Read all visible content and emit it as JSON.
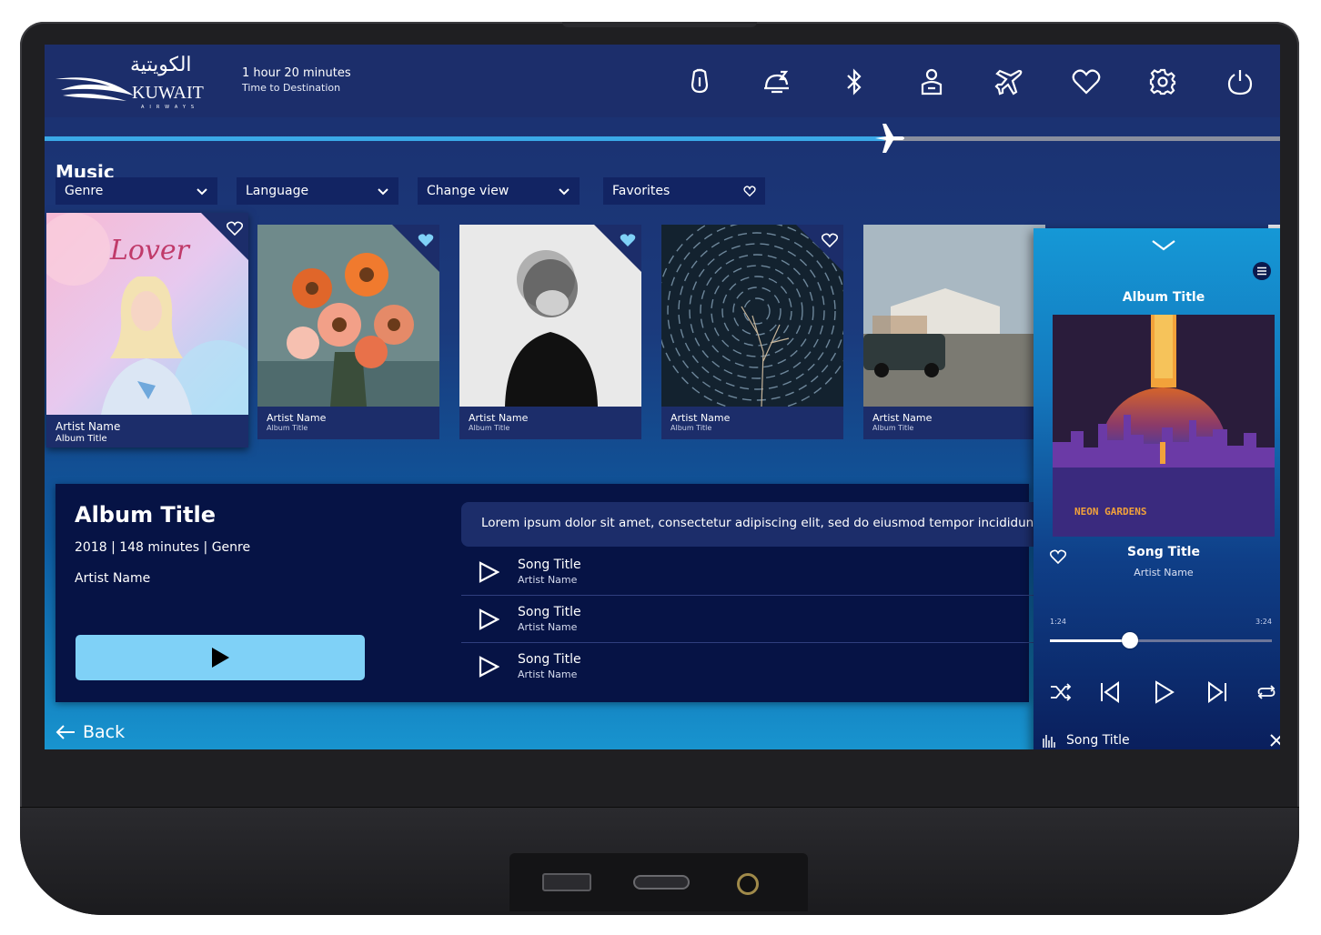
{
  "header": {
    "logo_arabic": "الكويتية",
    "logo_name": "KUWAIT",
    "logo_sub": "AIRWAYS",
    "flight_time": "1 hour 20 minutes",
    "flight_time_label": "Time to Destination",
    "flight_progress": 0.68,
    "icons": [
      "light-icon",
      "call-attendant-icon",
      "bluetooth-icon",
      "seat-icon",
      "flight-icon",
      "favorites-icon",
      "settings-icon",
      "power-icon"
    ]
  },
  "section": {
    "title": "Music"
  },
  "filters": [
    {
      "label": "Genre",
      "icon": "chevron-down-icon"
    },
    {
      "label": "Language",
      "icon": "chevron-down-icon"
    },
    {
      "label": "Change view",
      "icon": "chevron-down-icon"
    },
    {
      "label": "Favorites",
      "icon": "heart-icon"
    }
  ],
  "albums": [
    {
      "artist": "Artist Name",
      "album": "Album Title",
      "favorite": false,
      "cover_text": "Lover"
    },
    {
      "artist": "Artist Name",
      "album": "Album Title",
      "favorite": true
    },
    {
      "artist": "Artist Name",
      "album": "Album Title",
      "favorite": true
    },
    {
      "artist": "Artist Name",
      "album": "Album Title",
      "favorite": false
    },
    {
      "artist": "Artist Name",
      "album": "Album Title",
      "favorite": false
    }
  ],
  "detail": {
    "title": "Album Title",
    "meta": "2018 | 148 minutes | Genre",
    "artist": "Artist Name",
    "description": "Lorem ipsum dolor sit amet, consectetur adipiscing elit, sed do eiusmod tempor incididunt ut labore",
    "songs": [
      {
        "title": "Song Title",
        "artist": "Artist Name"
      },
      {
        "title": "Song Title",
        "artist": "Artist Name"
      },
      {
        "title": "Song Title",
        "artist": "Artist Name"
      }
    ]
  },
  "back_label": "Back",
  "player": {
    "album": "Album Title",
    "cover_text": "NEON GARDENS",
    "song": "Song Title",
    "artist": "Artist Name",
    "elapsed": "1:24",
    "total": "3:24",
    "progress": 0.36,
    "now_playing": "Song Title"
  },
  "colors": {
    "header": "#1c2e6b",
    "accent": "#3aa9e8",
    "play_button": "#7fd1f7",
    "panel": "#061345"
  }
}
